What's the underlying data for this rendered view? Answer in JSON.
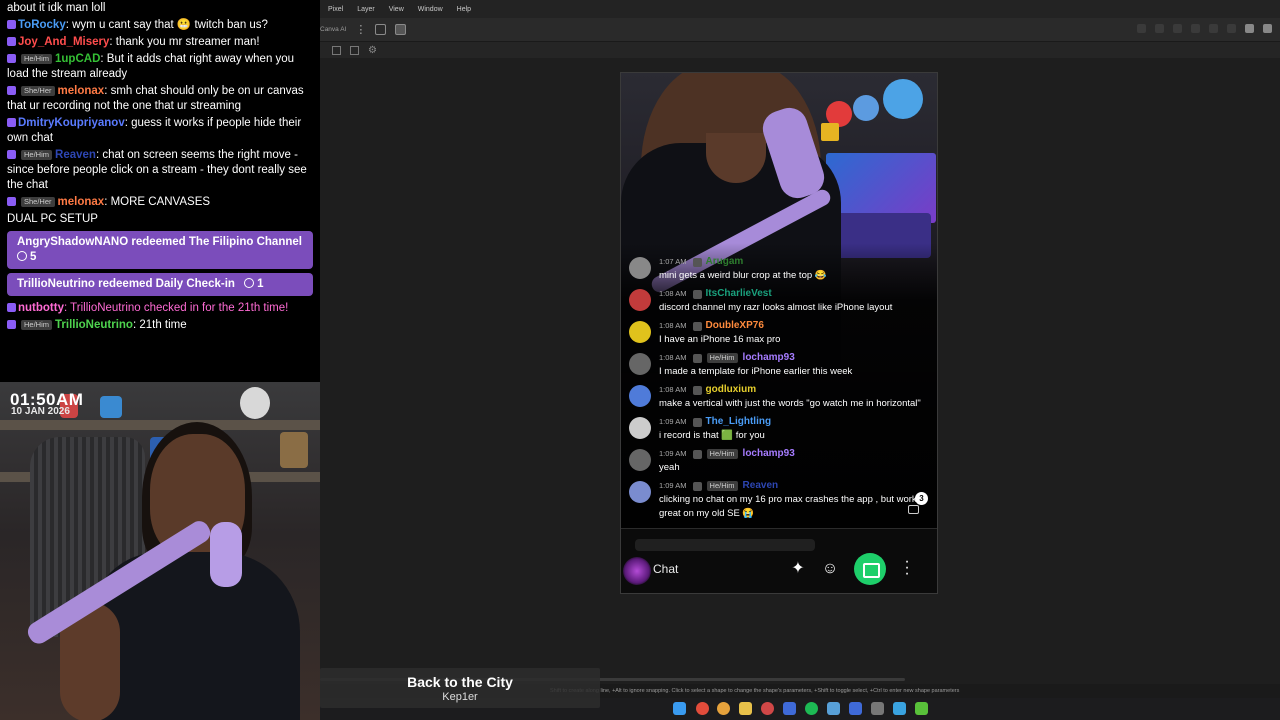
{
  "chat": {
    "lines": [
      {
        "user": "",
        "user_color": "#ffffff",
        "text": "about it idk man loll"
      },
      {
        "user": "ToRocky",
        "user_color": "#4a9cf5",
        "text": ": wym u cant say that 😬 twitch ban us?"
      },
      {
        "user": "Joy_And_Misery",
        "user_color": "#ff4d4d",
        "text": ": thank you mr streamer man!"
      },
      {
        "user": "1upCAD",
        "user_color": "#35c035",
        "pronoun": "He/Him",
        "text": ": But it adds chat right away when you load the stream already"
      },
      {
        "user": "melonax",
        "user_color": "#ff7a45",
        "pronoun": "She/Her",
        "text": ": smh chat should only be on ur canvas that ur recording not the one that ur streaming"
      },
      {
        "user": "DmitryKoupriyanov",
        "user_color": "#5a7bff",
        "text": ": guess it works if people hide their own chat"
      },
      {
        "user": "Reaven",
        "user_color": "#2d46b3",
        "pronoun": "He/Him",
        "text": ": chat on screen seems the right move - since before people click on a stream - they dont really see the chat"
      },
      {
        "user": "melonax",
        "user_color": "#ff7a45",
        "pronoun": "She/Her",
        "text": ": MORE CANVASES"
      },
      {
        "user": "",
        "user_color": "#ffffff",
        "text": "DUAL PC SETUP"
      }
    ],
    "rewards": [
      {
        "text": "AngryShadowNANO redeemed The Filipino Channel",
        "cost": "5"
      },
      {
        "text": "TrillioNeutrino redeemed Daily Check-in",
        "cost": "1"
      }
    ],
    "after_lines": [
      {
        "user": "nutbotty",
        "user_color": "#ff6bd4",
        "text": ": TrillioNeutrino checked in for the 21th time!",
        "text_color": "#ff6bd4"
      },
      {
        "user": "TrillioNeutrino",
        "user_color": "#4ed24e",
        "pronoun": "He/Him",
        "text": ": 21th time",
        "text_color": "#ffffff"
      }
    ]
  },
  "webcam": {
    "time": "01:50AM",
    "date": "10 JAN 2026"
  },
  "song": {
    "title": "Back to the City",
    "artist": "Kep1er"
  },
  "app": {
    "menu": [
      "Pixel",
      "Layer",
      "View",
      "Window",
      "Help"
    ],
    "toolbar_label": "Canva AI",
    "status_text": "Shift to create along line, +Alt to ignore snapping. Click to select a shape to change the shape's parameters, +Shift to toggle select, +Ctrl to enter new shape parameters"
  },
  "yt_chat": {
    "messages": [
      {
        "time": "1:07 AM",
        "user": "Arugam",
        "user_color": "#2e7d2e",
        "text": "mini gets a weird blur crop at the top 😂",
        "avatar": "#888888"
      },
      {
        "time": "1:08 AM",
        "user": "ItsCharlieVest",
        "user_color": "#1aa17d",
        "text": "discord channel my razr looks almost like iPhone layout",
        "avatar": "#c23b3b"
      },
      {
        "time": "1:08 AM",
        "user": "DoubleXP76",
        "user_color": "#ff8b3d",
        "text": "I have an iPhone 16 max pro",
        "avatar": "#e0c21c"
      },
      {
        "time": "1:08 AM",
        "user": "lochamp93",
        "user_color": "#a67cff",
        "pronoun": "He/Him",
        "text": "I made a template for iPhone earlier this week",
        "avatar": "#666666"
      },
      {
        "time": "1:08 AM",
        "user": "godluxium",
        "user_color": "#e6cf2d",
        "text": "make a vertical with just the words \"go watch me in horizontal\"",
        "avatar": "#4f7bd9"
      },
      {
        "time": "1:09 AM",
        "user": "The_Lightling",
        "user_color": "#4a9cf5",
        "text": "i record is that 🟩 for you",
        "avatar": "#cccccc"
      },
      {
        "time": "1:09 AM",
        "user": "lochamp93",
        "user_color": "#a67cff",
        "pronoun": "He/Him",
        "text": "yeah",
        "avatar": "#666666"
      },
      {
        "time": "1:09 AM",
        "user": "Reaven",
        "user_color": "#2d46b3",
        "pronoun": "He/Him",
        "text": "clicking no chat on my 16 pro max crashes the app , but works great on my old SE 😭",
        "avatar": "#7a8ccf"
      }
    ],
    "unread_count": "3",
    "input_label": "Chat"
  },
  "colors": {
    "accent_purple": "#7b4dbb",
    "shop_green": "#1ecf6a",
    "taskbar": "#1c1c1e"
  }
}
